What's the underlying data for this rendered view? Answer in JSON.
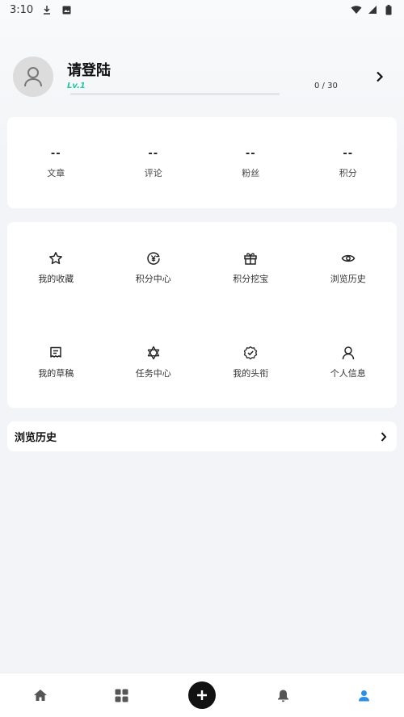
{
  "status_bar": {
    "time": "3:10",
    "icons": [
      "download-icon",
      "photo-icon",
      "wifi-icon",
      "battery-icon"
    ]
  },
  "profile": {
    "name": "请登陆",
    "level": "Lv.1",
    "progress_text": "0 / 30",
    "progress": 0,
    "accent_color": "#1ec8a6"
  },
  "stats": [
    {
      "value": "--",
      "label": "文章"
    },
    {
      "value": "--",
      "label": "评论"
    },
    {
      "value": "--",
      "label": "粉丝"
    },
    {
      "value": "--",
      "label": "积分"
    }
  ],
  "menu": [
    {
      "label": "我的收藏",
      "icon": "star-icon"
    },
    {
      "label": "积分中心",
      "icon": "yen-coin-icon"
    },
    {
      "label": "积分挖宝",
      "icon": "gift-icon"
    },
    {
      "label": "浏览历史",
      "icon": "eye-icon"
    },
    {
      "label": "我的草稿",
      "icon": "draft-icon"
    },
    {
      "label": "任务中心",
      "icon": "hexagram-icon"
    },
    {
      "label": "我的头衔",
      "icon": "badge-check-icon"
    },
    {
      "label": "个人信息",
      "icon": "person-icon"
    }
  ],
  "history_section": {
    "title": "浏览历史"
  },
  "bottom_nav": {
    "items": [
      "home-icon",
      "grid-icon",
      "plus-icon",
      "bell-icon",
      "user-icon"
    ],
    "active_color": "#2b8fe8"
  }
}
